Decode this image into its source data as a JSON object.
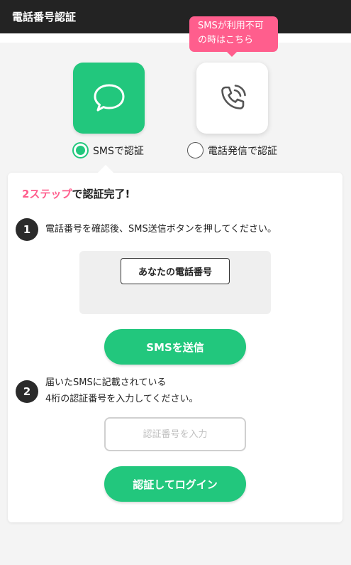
{
  "header": {
    "title": "電話番号認証"
  },
  "tooltip": {
    "line1": "SMSが利用不可",
    "line2": "の時はこちら"
  },
  "methods": {
    "sms": {
      "label": "SMSで認証",
      "selected": true,
      "icon": "chat-bubble-icon"
    },
    "call": {
      "label": "電話発信で認証",
      "selected": false,
      "icon": "phone-call-icon"
    }
  },
  "card": {
    "headline_accent": "2ステップ",
    "headline_rest": "で認証完了!",
    "step1": {
      "number": "1",
      "text": "電話番号を確認後、SMS送信ボタンを押してください。",
      "phone_placeholder": "あなたの電話番号",
      "button": "SMSを送信"
    },
    "step2": {
      "number": "2",
      "text_line1": "届いたSMSに記載されている",
      "text_line2": "4桁の認証番号を入力してください。",
      "input_placeholder": "認証番号を入力",
      "input_value": "",
      "button": "認証してログイン"
    }
  },
  "colors": {
    "accent": "#22c77d",
    "pink": "#ff5e8d",
    "header": "#232323"
  }
}
